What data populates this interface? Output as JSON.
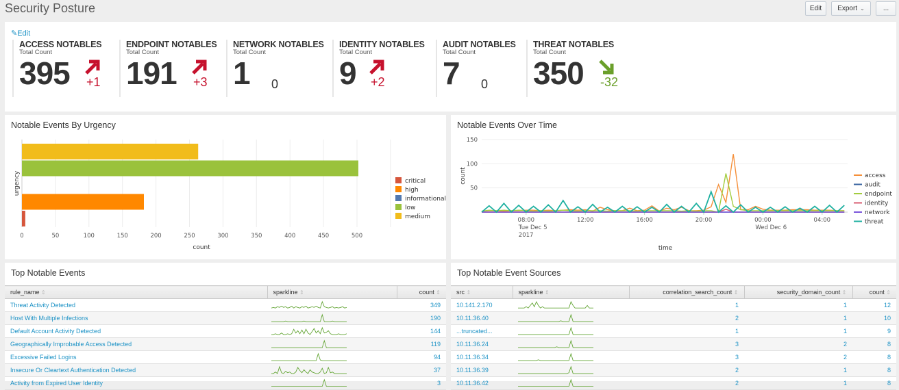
{
  "header": {
    "title": "Security Posture",
    "buttons": {
      "edit": "Edit",
      "export": "Export",
      "more": "..."
    }
  },
  "kpis": {
    "edit_label": "Edit",
    "items": [
      {
        "title": "ACCESS NOTABLES",
        "subtitle": "Total Count",
        "value": "395",
        "delta": "+1",
        "trend": "up"
      },
      {
        "title": "ENDPOINT NOTABLES",
        "subtitle": "Total Count",
        "value": "191",
        "delta": "+3",
        "trend": "up"
      },
      {
        "title": "NETWORK NOTABLES",
        "subtitle": "Total Count",
        "value": "1",
        "delta": "0",
        "trend": "none"
      },
      {
        "title": "IDENTITY NOTABLES",
        "subtitle": "Total Count",
        "value": "9",
        "delta": "+2",
        "trend": "up"
      },
      {
        "title": "AUDIT NOTABLES",
        "subtitle": "Total Count",
        "value": "7",
        "delta": "0",
        "trend": "none"
      },
      {
        "title": "THREAT NOTABLES",
        "subtitle": "Total Count",
        "value": "350",
        "delta": "-32",
        "trend": "down"
      }
    ],
    "colors": {
      "up": "#c6112d",
      "down": "#6a9f2a"
    }
  },
  "chart_data": [
    {
      "type": "bar",
      "orientation": "horizontal",
      "title": "Notable Events By Urgency",
      "xlabel": "count",
      "ylabel": "urgency",
      "xlim": [
        0,
        550
      ],
      "xticks": [
        0,
        50,
        100,
        150,
        200,
        250,
        300,
        350,
        400,
        450,
        500
      ],
      "grid": true,
      "legend_position": "right",
      "categories": [
        "medium",
        "low",
        "informational",
        "high",
        "critical"
      ],
      "values": [
        263,
        502,
        0,
        182,
        5
      ],
      "legend": [
        {
          "name": "critical",
          "color": "#d6563c"
        },
        {
          "name": "high",
          "color": "#ff8800"
        },
        {
          "name": "informational",
          "color": "#5379af"
        },
        {
          "name": "low",
          "color": "#9ac23c"
        },
        {
          "name": "medium",
          "color": "#f1bc1b"
        }
      ]
    },
    {
      "type": "line",
      "title": "Notable Events Over Time",
      "xlabel": "time",
      "ylabel": "count",
      "ylim": [
        0,
        150
      ],
      "yticks": [
        50,
        100,
        150
      ],
      "x_start_hour": 5,
      "x_step_minutes": 30,
      "xticks": [
        {
          "hour": 8,
          "label": [
            "08:00",
            "Tue Dec 5",
            "2017"
          ]
        },
        {
          "hour": 12,
          "label": [
            "12:00"
          ]
        },
        {
          "hour": 16,
          "label": [
            "16:00"
          ]
        },
        {
          "hour": 20,
          "label": [
            "20:00"
          ]
        },
        {
          "hour": 24,
          "label": [
            "00:00",
            "Wed Dec 6"
          ]
        },
        {
          "hour": 28,
          "label": [
            "04:00"
          ]
        }
      ],
      "grid": true,
      "legend_position": "right",
      "series": [
        {
          "name": "access",
          "color": "#f58f39",
          "values": [
            2,
            3,
            3,
            2,
            3,
            3,
            4,
            4,
            3,
            4,
            3,
            4,
            5,
            4,
            5,
            2,
            10,
            5,
            3,
            3,
            8,
            3,
            4,
            13,
            2,
            8,
            5,
            10,
            3,
            3,
            4,
            11,
            57,
            20,
            120,
            5,
            5,
            12,
            6,
            4,
            4,
            4,
            5,
            5,
            5,
            4,
            4,
            4,
            3,
            3
          ]
        },
        {
          "name": "audit",
          "color": "#3863a0",
          "values": [
            0,
            0,
            0,
            0,
            0,
            0,
            0,
            0,
            0,
            0,
            0,
            0,
            0,
            0,
            0,
            0,
            0,
            0,
            0,
            0,
            0,
            0,
            0,
            0,
            0,
            0,
            0,
            0,
            0,
            0,
            0,
            0,
            0,
            0,
            0,
            0,
            0,
            0,
            0,
            0,
            0,
            0,
            0,
            0,
            0,
            0,
            0,
            0,
            0,
            0
          ]
        },
        {
          "name": "endpoint",
          "color": "#a2cc3e",
          "values": [
            2,
            4,
            3,
            4,
            3,
            4,
            3,
            2,
            3,
            2,
            3,
            4,
            3,
            2,
            3,
            3,
            3,
            2,
            3,
            3,
            3,
            2,
            3,
            3,
            3,
            3,
            3,
            2,
            3,
            2,
            3,
            3,
            0,
            80,
            12,
            5,
            3,
            3,
            3,
            3,
            3,
            3,
            3,
            3,
            3,
            3,
            3,
            3,
            3,
            3
          ]
        },
        {
          "name": "identity",
          "color": "#d85d72",
          "values": [
            0,
            0,
            0,
            0,
            0,
            0,
            0,
            0,
            0,
            0,
            0,
            0,
            0,
            0,
            0,
            0,
            0,
            0,
            0,
            0,
            0,
            0,
            0,
            0,
            0,
            0,
            0,
            0,
            0,
            0,
            0,
            0,
            0,
            6,
            0,
            0,
            0,
            0,
            0,
            0,
            0,
            0,
            0,
            0,
            0,
            0,
            0,
            0,
            0,
            0
          ]
        },
        {
          "name": "network",
          "color": "#7b56db",
          "values": [
            0,
            0,
            0,
            0,
            0,
            0,
            0,
            0,
            0,
            0,
            0,
            0,
            0,
            0,
            0,
            0,
            0,
            0,
            0,
            0,
            0,
            0,
            0,
            0,
            0,
            0,
            0,
            0,
            0,
            0,
            0,
            0,
            0,
            0,
            0,
            0,
            0,
            0,
            0,
            0,
            0,
            0,
            0,
            0,
            0,
            0,
            0,
            0,
            0,
            0
          ]
        },
        {
          "name": "threat",
          "color": "#1eb0a0",
          "values": [
            0,
            13,
            0,
            18,
            0,
            14,
            0,
            12,
            0,
            15,
            0,
            24,
            0,
            11,
            0,
            16,
            0,
            10,
            0,
            12,
            0,
            11,
            0,
            10,
            0,
            16,
            0,
            12,
            0,
            18,
            0,
            42,
            0,
            13,
            0,
            15,
            0,
            10,
            0,
            10,
            0,
            11,
            0,
            8,
            0,
            12,
            0,
            14,
            0,
            14
          ]
        }
      ]
    }
  ],
  "urgency_panel": {
    "title": "Notable Events By Urgency"
  },
  "time_panel": {
    "title": "Notable Events Over Time"
  },
  "top_events": {
    "title": "Top Notable Events",
    "columns": [
      "rule_name",
      "sparkline",
      "count"
    ],
    "rows": [
      {
        "rule_name": "Threat Activity Detected",
        "count": "349",
        "spark": [
          2,
          3,
          2,
          4,
          3,
          5,
          3,
          4,
          2,
          3,
          5,
          2,
          4,
          3,
          2,
          4,
          3,
          5,
          2,
          3,
          4,
          3,
          5,
          3,
          2,
          12,
          4,
          3,
          2,
          3,
          4,
          2,
          3,
          2,
          3,
          4,
          2,
          3
        ]
      },
      {
        "rule_name": "Host With Multiple Infections",
        "count": "190",
        "spark": [
          1,
          1,
          1,
          1,
          1,
          1,
          1,
          2,
          1,
          1,
          1,
          1,
          1,
          1,
          1,
          1,
          2,
          1,
          1,
          1,
          1,
          1,
          1,
          1,
          1,
          12,
          1,
          1,
          1,
          1,
          2,
          1,
          1,
          1,
          1,
          1,
          1,
          1
        ]
      },
      {
        "rule_name": "Default Account Activity Detected",
        "count": "144",
        "spark": [
          1,
          1,
          2,
          1,
          1,
          3,
          1,
          1,
          2,
          1,
          2,
          8,
          3,
          6,
          2,
          7,
          2,
          8,
          3,
          1,
          5,
          9,
          3,
          6,
          2,
          10,
          3,
          4,
          6,
          2,
          1,
          1,
          1,
          2,
          1,
          1,
          1,
          2
        ]
      },
      {
        "rule_name": "Geographically Improbable Access Detected",
        "count": "119",
        "spark": [
          1,
          1,
          1,
          1,
          1,
          1,
          1,
          1,
          1,
          1,
          1,
          1,
          1,
          1,
          1,
          1,
          1,
          1,
          1,
          1,
          1,
          1,
          1,
          1,
          1,
          1,
          12,
          1,
          1,
          1,
          1,
          1,
          1,
          1,
          1,
          1,
          1,
          1
        ]
      },
      {
        "rule_name": "Excessive Failed Logins",
        "count": "94",
        "spark": [
          1,
          1,
          1,
          1,
          1,
          1,
          1,
          1,
          1,
          1,
          1,
          1,
          1,
          1,
          1,
          1,
          1,
          1,
          1,
          1,
          1,
          1,
          1,
          12,
          2,
          1,
          1,
          1,
          1,
          1,
          1,
          1,
          1,
          1,
          1,
          1,
          1,
          1
        ]
      },
      {
        "rule_name": "Insecure Or Cleartext Authentication Detected",
        "count": "37",
        "spark": [
          1,
          1,
          3,
          1,
          10,
          2,
          1,
          4,
          2,
          3,
          1,
          1,
          3,
          9,
          5,
          2,
          6,
          3,
          1,
          6,
          3,
          2,
          1,
          1,
          3,
          8,
          1,
          2,
          9,
          2,
          3,
          1,
          1,
          1,
          1,
          1,
          1,
          1
        ]
      },
      {
        "rule_name": "Activity from Expired User Identity",
        "count": "3",
        "spark": [
          1,
          1,
          1,
          1,
          1,
          1,
          1,
          1,
          1,
          1,
          1,
          1,
          1,
          1,
          1,
          1,
          1,
          1,
          1,
          1,
          1,
          1,
          1,
          1,
          1,
          1,
          8,
          1,
          1,
          1,
          1,
          1,
          1,
          1,
          1,
          1,
          1,
          1
        ]
      }
    ]
  },
  "top_sources": {
    "title": "Top Notable Event Sources",
    "columns": [
      "src",
      "sparkline",
      "correlation_search_count",
      "security_domain_count",
      "count"
    ],
    "rows": [
      {
        "src": "10.141.2.170",
        "correlation_search_count": "1",
        "security_domain_count": "1",
        "count": "12",
        "spark": [
          1,
          1,
          1,
          1,
          2,
          1,
          3,
          5,
          2,
          6,
          3,
          1,
          2,
          1,
          1,
          1,
          1,
          1,
          1,
          1,
          1,
          1,
          1,
          1,
          1,
          1,
          6,
          3,
          1,
          1,
          1,
          1,
          1,
          1,
          3,
          1,
          1,
          1
        ]
      },
      {
        "src": "10.11.36.40",
        "correlation_search_count": "2",
        "security_domain_count": "1",
        "count": "10",
        "spark": [
          1,
          1,
          1,
          1,
          1,
          1,
          1,
          1,
          1,
          1,
          1,
          1,
          1,
          1,
          1,
          1,
          1,
          1,
          1,
          1,
          1,
          2,
          1,
          1,
          1,
          1,
          10,
          1,
          1,
          1,
          1,
          1,
          1,
          1,
          1,
          1,
          1,
          1
        ]
      },
      {
        "src": "...truncated...",
        "correlation_search_count": "1",
        "security_domain_count": "1",
        "count": "9",
        "spark": [
          1,
          1,
          1,
          1,
          1,
          1,
          1,
          1,
          1,
          1,
          1,
          1,
          1,
          1,
          1,
          1,
          1,
          1,
          1,
          1,
          1,
          1,
          1,
          1,
          1,
          1,
          10,
          1,
          1,
          1,
          1,
          1,
          1,
          1,
          1,
          1,
          1,
          1
        ]
      },
      {
        "src": "10.11.36.24",
        "correlation_search_count": "3",
        "security_domain_count": "2",
        "count": "8",
        "spark": [
          1,
          1,
          1,
          1,
          1,
          1,
          1,
          1,
          1,
          1,
          1,
          1,
          1,
          1,
          1,
          1,
          1,
          1,
          1,
          2,
          1,
          1,
          1,
          1,
          1,
          1,
          10,
          1,
          1,
          1,
          1,
          1,
          1,
          1,
          1,
          1,
          1,
          1
        ]
      },
      {
        "src": "10.11.36.34",
        "correlation_search_count": "3",
        "security_domain_count": "2",
        "count": "8",
        "spark": [
          1,
          1,
          1,
          1,
          1,
          1,
          1,
          1,
          1,
          1,
          2,
          1,
          1,
          1,
          1,
          1,
          1,
          1,
          1,
          1,
          1,
          1,
          1,
          1,
          1,
          1,
          10,
          1,
          1,
          1,
          1,
          1,
          1,
          1,
          1,
          1,
          1,
          1
        ]
      },
      {
        "src": "10.11.36.39",
        "correlation_search_count": "2",
        "security_domain_count": "1",
        "count": "8",
        "spark": [
          1,
          1,
          1,
          1,
          1,
          1,
          1,
          1,
          1,
          1,
          1,
          1,
          1,
          1,
          1,
          1,
          1,
          1,
          1,
          1,
          1,
          1,
          1,
          1,
          1,
          2,
          10,
          1,
          1,
          1,
          1,
          1,
          1,
          1,
          1,
          1,
          1,
          1
        ]
      },
      {
        "src": "10.11.36.42",
        "correlation_search_count": "2",
        "security_domain_count": "1",
        "count": "8",
        "spark": [
          1,
          1,
          1,
          1,
          1,
          1,
          1,
          1,
          1,
          1,
          1,
          1,
          1,
          1,
          1,
          1,
          1,
          1,
          1,
          1,
          1,
          1,
          1,
          1,
          1,
          1,
          8,
          1,
          1,
          1,
          1,
          1,
          1,
          1,
          1,
          1,
          1,
          1
        ]
      }
    ]
  },
  "sparkline_color": "#65a637"
}
